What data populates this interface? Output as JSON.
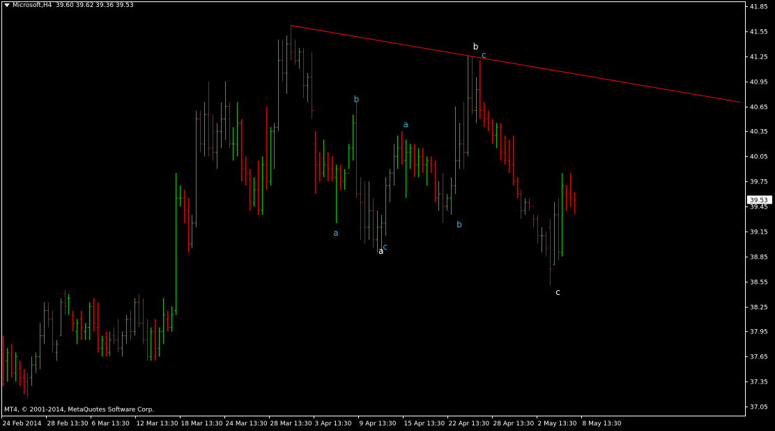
{
  "header": {
    "symbol": "Microsoft,H4",
    "ohlc": "39.60 39.62 39.36 39.53"
  },
  "footer": {
    "copyright": "MT4, © 2001-2014, MetaQuotes Software Corp."
  },
  "colors": {
    "background": "#000000",
    "axis": "#ffffff",
    "bull": "#00c800",
    "bear": "#e00000",
    "trendline": "#ff0000",
    "label_cyan": "#22bbdd",
    "label_white": "#ffffff"
  },
  "chart_data": {
    "type": "ohlc",
    "title": "",
    "xlabel": "",
    "ylabel": "",
    "ylim": [
      37.0,
      41.85
    ],
    "y_ticks": [
      "41.85",
      "41.55",
      "41.25",
      "40.95",
      "40.65",
      "40.35",
      "40.05",
      "39.75",
      "39.45",
      "39.15",
      "38.85",
      "38.55",
      "38.25",
      "37.95",
      "37.65",
      "37.35",
      "37.05"
    ],
    "x_ticks": [
      "24 Feb 2014",
      "28 Feb 13:30",
      "6 Mar 13:30",
      "12 Mar 13:30",
      "18 Mar 13:30",
      "24 Mar 13:30",
      "28 Mar 13:30",
      "3 Apr 13:30",
      "9 Apr 13:30",
      "15 Apr 13:30",
      "22 Apr 13:30",
      "28 Apr 13:30",
      "2 May 13:30",
      "8 May 13:30"
    ],
    "current_price": "39.53",
    "trendline": {
      "from": {
        "bar": 70,
        "price": 41.62
      },
      "to": {
        "bar": 176,
        "price": 40.7
      }
    },
    "wave_labels": [
      {
        "text": "a",
        "bar": 81,
        "price": 39.1,
        "color": "cyan"
      },
      {
        "text": "b",
        "bar": 86,
        "price": 40.7,
        "color": "cyan"
      },
      {
        "text": "a",
        "bar": 92,
        "price": 38.88,
        "color": "white"
      },
      {
        "text": "c",
        "bar": 93,
        "price": 38.93,
        "color": "cyan"
      },
      {
        "text": "a",
        "bar": 98,
        "price": 40.4,
        "color": "cyan"
      },
      {
        "text": "b",
        "bar": 111,
        "price": 39.2,
        "color": "cyan"
      },
      {
        "text": "b",
        "bar": 115,
        "price": 41.33,
        "color": "white"
      },
      {
        "text": "c",
        "bar": 117,
        "price": 41.23,
        "color": "cyan"
      },
      {
        "text": "c",
        "bar": 135,
        "price": 38.39,
        "color": "white"
      }
    ],
    "bars": [
      {
        "o": 37.7,
        "h": 37.9,
        "l": 37.3,
        "c": 37.6
      },
      {
        "o": 37.6,
        "h": 37.75,
        "l": 37.35,
        "c": 37.7
      },
      {
        "o": 37.68,
        "h": 37.8,
        "l": 37.4,
        "c": 37.45
      },
      {
        "o": 37.45,
        "h": 37.7,
        "l": 37.35,
        "c": 37.65
      },
      {
        "o": 37.5,
        "h": 37.6,
        "l": 37.3,
        "c": 37.4
      },
      {
        "o": 37.4,
        "h": 37.5,
        "l": 37.2,
        "c": 37.35
      },
      {
        "o": 37.35,
        "h": 37.45,
        "l": 37.15,
        "c": 37.2
      },
      {
        "o": 37.4,
        "h": 37.65,
        "l": 37.3,
        "c": 37.55
      },
      {
        "o": 37.55,
        "h": 37.7,
        "l": 37.45,
        "c": 37.65
      },
      {
        "o": 37.65,
        "h": 38.05,
        "l": 37.5,
        "c": 37.9
      },
      {
        "o": 37.9,
        "h": 38.3,
        "l": 37.8,
        "c": 38.2
      },
      {
        "o": 38.2,
        "h": 38.3,
        "l": 38.0,
        "c": 38.1
      },
      {
        "o": 38.1,
        "h": 38.2,
        "l": 37.7,
        "c": 37.8
      },
      {
        "o": 37.7,
        "h": 37.85,
        "l": 37.6,
        "c": 37.8
      },
      {
        "o": 37.9,
        "h": 38.35,
        "l": 37.9,
        "c": 38.3
      },
      {
        "o": 38.4,
        "h": 38.45,
        "l": 38.15,
        "c": 38.25
      },
      {
        "o": 38.35,
        "h": 38.4,
        "l": 38.15,
        "c": 38.35
      },
      {
        "o": 38.15,
        "h": 38.2,
        "l": 37.95,
        "c": 38.05
      },
      {
        "o": 37.95,
        "h": 38.1,
        "l": 37.8,
        "c": 38.05
      },
      {
        "o": 38.1,
        "h": 38.2,
        "l": 37.85,
        "c": 38.0
      },
      {
        "o": 37.95,
        "h": 38.05,
        "l": 37.85,
        "c": 38.0
      },
      {
        "o": 38.0,
        "h": 38.3,
        "l": 37.85,
        "c": 38.25
      },
      {
        "o": 38.25,
        "h": 38.35,
        "l": 37.95,
        "c": 38.05
      },
      {
        "o": 38.0,
        "h": 38.3,
        "l": 37.7,
        "c": 37.75
      },
      {
        "o": 37.75,
        "h": 37.9,
        "l": 37.65,
        "c": 37.85
      },
      {
        "o": 37.8,
        "h": 37.95,
        "l": 37.65,
        "c": 37.75
      },
      {
        "o": 37.7,
        "h": 37.95,
        "l": 37.65,
        "c": 37.85
      },
      {
        "o": 37.9,
        "h": 38.0,
        "l": 37.8,
        "c": 37.85
      },
      {
        "o": 37.85,
        "h": 38.1,
        "l": 37.7,
        "c": 37.75
      },
      {
        "o": 37.75,
        "h": 37.95,
        "l": 37.65,
        "c": 37.9
      },
      {
        "o": 37.9,
        "h": 38.15,
        "l": 37.8,
        "c": 38.1
      },
      {
        "o": 38.1,
        "h": 38.2,
        "l": 37.85,
        "c": 37.95
      },
      {
        "o": 37.95,
        "h": 38.35,
        "l": 37.9,
        "c": 38.3
      },
      {
        "o": 38.3,
        "h": 38.4,
        "l": 38.0,
        "c": 38.05
      },
      {
        "o": 38.05,
        "h": 38.35,
        "l": 37.8,
        "c": 37.85
      },
      {
        "o": 37.85,
        "h": 38.1,
        "l": 37.6,
        "c": 37.65
      },
      {
        "o": 37.65,
        "h": 38.0,
        "l": 37.6,
        "c": 37.95
      },
      {
        "o": 37.95,
        "h": 38.1,
        "l": 37.6,
        "c": 37.65
      },
      {
        "o": 37.75,
        "h": 38.0,
        "l": 37.65,
        "c": 37.95
      },
      {
        "o": 37.95,
        "h": 38.35,
        "l": 37.8,
        "c": 38.15
      },
      {
        "o": 38.1,
        "h": 38.2,
        "l": 37.95,
        "c": 38.0
      },
      {
        "o": 38.0,
        "h": 38.25,
        "l": 37.95,
        "c": 38.15
      },
      {
        "o": 38.2,
        "h": 39.85,
        "l": 38.15,
        "c": 39.55
      },
      {
        "o": 39.55,
        "h": 39.7,
        "l": 39.45,
        "c": 39.55
      },
      {
        "o": 39.55,
        "h": 39.65,
        "l": 39.25,
        "c": 39.35
      },
      {
        "o": 39.4,
        "h": 39.55,
        "l": 38.9,
        "c": 39.0
      },
      {
        "o": 39.0,
        "h": 39.35,
        "l": 38.95,
        "c": 39.25
      },
      {
        "o": 39.25,
        "h": 40.6,
        "l": 39.2,
        "c": 40.5
      },
      {
        "o": 40.5,
        "h": 40.6,
        "l": 40.1,
        "c": 40.2
      },
      {
        "o": 40.2,
        "h": 40.7,
        "l": 40.05,
        "c": 40.55
      },
      {
        "o": 40.55,
        "h": 40.95,
        "l": 40.05,
        "c": 40.15
      },
      {
        "o": 40.15,
        "h": 40.55,
        "l": 40.0,
        "c": 40.1
      },
      {
        "o": 40.1,
        "h": 40.45,
        "l": 39.9,
        "c": 40.35
      },
      {
        "o": 40.35,
        "h": 40.7,
        "l": 40.15,
        "c": 40.5
      },
      {
        "o": 40.5,
        "h": 40.95,
        "l": 40.25,
        "c": 40.65
      },
      {
        "o": 40.65,
        "h": 40.7,
        "l": 40.15,
        "c": 40.2
      },
      {
        "o": 40.2,
        "h": 40.4,
        "l": 40.0,
        "c": 40.2
      },
      {
        "o": 40.2,
        "h": 40.7,
        "l": 40.05,
        "c": 40.45
      },
      {
        "o": 40.45,
        "h": 40.5,
        "l": 39.75,
        "c": 39.9
      },
      {
        "o": 39.9,
        "h": 40.05,
        "l": 39.7,
        "c": 39.85
      },
      {
        "o": 39.85,
        "h": 39.9,
        "l": 39.4,
        "c": 39.5
      },
      {
        "o": 39.5,
        "h": 39.8,
        "l": 39.45,
        "c": 39.65
      },
      {
        "o": 39.65,
        "h": 40.0,
        "l": 39.35,
        "c": 39.4
      },
      {
        "o": 39.4,
        "h": 40.05,
        "l": 39.35,
        "c": 39.95
      },
      {
        "o": 39.95,
        "h": 40.65,
        "l": 39.65,
        "c": 39.75
      },
      {
        "o": 39.75,
        "h": 40.4,
        "l": 39.7,
        "c": 40.35
      },
      {
        "o": 40.35,
        "h": 40.45,
        "l": 39.9,
        "c": 40.4
      },
      {
        "o": 40.4,
        "h": 41.45,
        "l": 40.35,
        "c": 41.2
      },
      {
        "o": 41.2,
        "h": 41.45,
        "l": 40.95,
        "c": 41.05
      },
      {
        "o": 41.05,
        "h": 41.5,
        "l": 40.8,
        "c": 41.4
      },
      {
        "o": 41.4,
        "h": 41.62,
        "l": 41.2,
        "c": 41.3
      },
      {
        "o": 41.3,
        "h": 41.45,
        "l": 41.15,
        "c": 41.2
      },
      {
        "o": 41.2,
        "h": 41.35,
        "l": 41.1,
        "c": 41.3
      },
      {
        "o": 41.3,
        "h": 41.35,
        "l": 40.75,
        "c": 40.9
      },
      {
        "o": 40.9,
        "h": 41.05,
        "l": 40.7,
        "c": 41.0
      },
      {
        "o": 41.0,
        "h": 41.3,
        "l": 40.5,
        "c": 40.6
      },
      {
        "o": 40.2,
        "h": 40.35,
        "l": 39.6,
        "c": 39.95
      },
      {
        "o": 39.95,
        "h": 40.1,
        "l": 39.75,
        "c": 39.85
      },
      {
        "o": 39.85,
        "h": 40.25,
        "l": 39.8,
        "c": 39.95
      },
      {
        "o": 39.95,
        "h": 40.1,
        "l": 39.75,
        "c": 39.9
      },
      {
        "o": 39.9,
        "h": 40.05,
        "l": 39.75,
        "c": 39.8
      },
      {
        "o": 39.8,
        "h": 39.95,
        "l": 39.25,
        "c": 39.9
      },
      {
        "o": 39.9,
        "h": 39.95,
        "l": 39.65,
        "c": 39.75
      },
      {
        "o": 39.75,
        "h": 39.9,
        "l": 39.65,
        "c": 39.85
      },
      {
        "o": 39.85,
        "h": 40.2,
        "l": 39.9,
        "c": 40.15
      },
      {
        "o": 40.15,
        "h": 40.55,
        "l": 40.0,
        "c": 40.45
      },
      {
        "o": 40.45,
        "h": 40.7,
        "l": 39.55,
        "c": 39.6
      },
      {
        "o": 39.6,
        "h": 39.8,
        "l": 39.05,
        "c": 39.5
      },
      {
        "o": 39.5,
        "h": 39.75,
        "l": 39.0,
        "c": 39.2
      },
      {
        "o": 39.2,
        "h": 39.75,
        "l": 39.05,
        "c": 39.4
      },
      {
        "o": 39.4,
        "h": 39.55,
        "l": 38.95,
        "c": 39.05
      },
      {
        "o": 39.05,
        "h": 39.4,
        "l": 38.9,
        "c": 39.2
      },
      {
        "o": 39.2,
        "h": 39.35,
        "l": 38.9,
        "c": 39.25
      },
      {
        "o": 39.25,
        "h": 39.8,
        "l": 39.1,
        "c": 39.7
      },
      {
        "o": 39.7,
        "h": 39.9,
        "l": 39.5,
        "c": 39.85
      },
      {
        "o": 39.85,
        "h": 40.2,
        "l": 39.7,
        "c": 40.05
      },
      {
        "o": 40.05,
        "h": 40.3,
        "l": 39.9,
        "c": 40.15
      },
      {
        "o": 40.15,
        "h": 40.35,
        "l": 39.95,
        "c": 40.0
      },
      {
        "o": 40.0,
        "h": 40.25,
        "l": 39.55,
        "c": 40.1
      },
      {
        "o": 40.1,
        "h": 40.2,
        "l": 39.9,
        "c": 40.15
      },
      {
        "o": 40.15,
        "h": 40.2,
        "l": 39.8,
        "c": 39.95
      },
      {
        "o": 39.95,
        "h": 40.15,
        "l": 39.8,
        "c": 40.05
      },
      {
        "o": 40.05,
        "h": 40.15,
        "l": 39.85,
        "c": 39.95
      },
      {
        "o": 39.95,
        "h": 40.05,
        "l": 39.7,
        "c": 40.0
      },
      {
        "o": 40.0,
        "h": 40.05,
        "l": 39.85,
        "c": 39.95
      },
      {
        "o": 39.95,
        "h": 40.0,
        "l": 39.5,
        "c": 39.55
      },
      {
        "o": 39.55,
        "h": 39.75,
        "l": 39.4,
        "c": 39.6
      },
      {
        "o": 39.6,
        "h": 39.85,
        "l": 39.25,
        "c": 39.45
      },
      {
        "o": 39.45,
        "h": 39.6,
        "l": 39.4,
        "c": 39.55
      },
      {
        "o": 39.55,
        "h": 39.8,
        "l": 39.35,
        "c": 39.7
      },
      {
        "o": 39.7,
        "h": 40.65,
        "l": 39.6,
        "c": 40.0
      },
      {
        "o": 40.0,
        "h": 40.45,
        "l": 39.9,
        "c": 40.2
      },
      {
        "o": 40.2,
        "h": 40.7,
        "l": 39.9,
        "c": 40.1
      },
      {
        "o": 40.1,
        "h": 41.25,
        "l": 40.05,
        "c": 40.75
      },
      {
        "o": 40.75,
        "h": 41.25,
        "l": 40.55,
        "c": 40.6
      },
      {
        "o": 40.6,
        "h": 41.0,
        "l": 40.45,
        "c": 40.85
      },
      {
        "o": 40.85,
        "h": 41.2,
        "l": 40.5,
        "c": 40.6
      },
      {
        "o": 40.6,
        "h": 40.7,
        "l": 40.4,
        "c": 40.5
      },
      {
        "o": 40.5,
        "h": 40.6,
        "l": 40.35,
        "c": 40.45
      },
      {
        "o": 40.45,
        "h": 40.5,
        "l": 40.2,
        "c": 40.3
      },
      {
        "o": 40.3,
        "h": 40.45,
        "l": 40.15,
        "c": 40.4
      },
      {
        "o": 40.4,
        "h": 40.45,
        "l": 40.0,
        "c": 40.1
      },
      {
        "o": 40.1,
        "h": 40.3,
        "l": 39.95,
        "c": 40.0
      },
      {
        "o": 40.0,
        "h": 40.25,
        "l": 39.85,
        "c": 39.95
      },
      {
        "o": 39.95,
        "h": 40.3,
        "l": 39.7,
        "c": 39.75
      },
      {
        "o": 39.75,
        "h": 39.8,
        "l": 39.55,
        "c": 39.6
      },
      {
        "o": 39.6,
        "h": 39.65,
        "l": 39.3,
        "c": 39.4
      },
      {
        "o": 39.4,
        "h": 39.55,
        "l": 39.35,
        "c": 39.5
      },
      {
        "o": 39.5,
        "h": 39.55,
        "l": 39.4,
        "c": 39.45
      },
      {
        "o": 39.45,
        "h": 39.35,
        "l": 39.2,
        "c": 39.3
      },
      {
        "o": 39.3,
        "h": 39.35,
        "l": 39.0,
        "c": 39.1
      },
      {
        "o": 39.1,
        "h": 39.2,
        "l": 38.9,
        "c": 39.1
      },
      {
        "o": 39.1,
        "h": 39.15,
        "l": 38.85,
        "c": 38.95
      },
      {
        "o": 39.2,
        "h": 39.3,
        "l": 38.5,
        "c": 38.7
      },
      {
        "o": 38.75,
        "h": 39.5,
        "l": 38.75,
        "c": 39.35
      },
      {
        "o": 39.35,
        "h": 39.55,
        "l": 38.8,
        "c": 38.9
      },
      {
        "o": 38.9,
        "h": 39.85,
        "l": 38.85,
        "c": 39.7
      },
      {
        "o": 39.7,
        "h": 39.7,
        "l": 39.4,
        "c": 39.6
      },
      {
        "o": 39.6,
        "h": 39.85,
        "l": 39.45,
        "c": 39.55
      },
      {
        "o": 39.6,
        "h": 39.62,
        "l": 39.36,
        "c": 39.53
      }
    ]
  }
}
